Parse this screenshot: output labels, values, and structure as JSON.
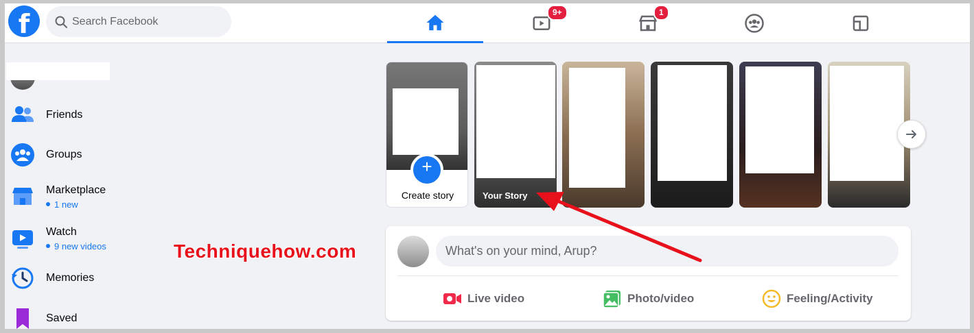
{
  "search": {
    "placeholder": "Search Facebook"
  },
  "nav": {
    "tabs": [
      {
        "name": "home",
        "active": true
      },
      {
        "name": "watch",
        "badge": "9+"
      },
      {
        "name": "marketplace",
        "badge": "1"
      },
      {
        "name": "groups"
      },
      {
        "name": "gaming"
      }
    ]
  },
  "sidebar": {
    "items": [
      {
        "label": "Friends",
        "icon": "friends-icon"
      },
      {
        "label": "Groups",
        "icon": "groups-icon"
      },
      {
        "label": "Marketplace",
        "sub": "1 new",
        "icon": "marketplace-icon"
      },
      {
        "label": "Watch",
        "sub": "9 new videos",
        "icon": "watch-icon"
      },
      {
        "label": "Memories",
        "icon": "memories-icon"
      },
      {
        "label": "Saved",
        "icon": "saved-icon"
      }
    ]
  },
  "stories": {
    "create_label": "Create story",
    "your_story_label": "Your Story"
  },
  "composer": {
    "prompt": "What's on your mind, Arup?",
    "actions": [
      "Live video",
      "Photo/video",
      "Feeling/Activity"
    ]
  },
  "watermark": "Techniquehow.com",
  "colors": {
    "brand": "#1877f2",
    "badge": "#e41e3f",
    "arrow": "#e8101a"
  }
}
